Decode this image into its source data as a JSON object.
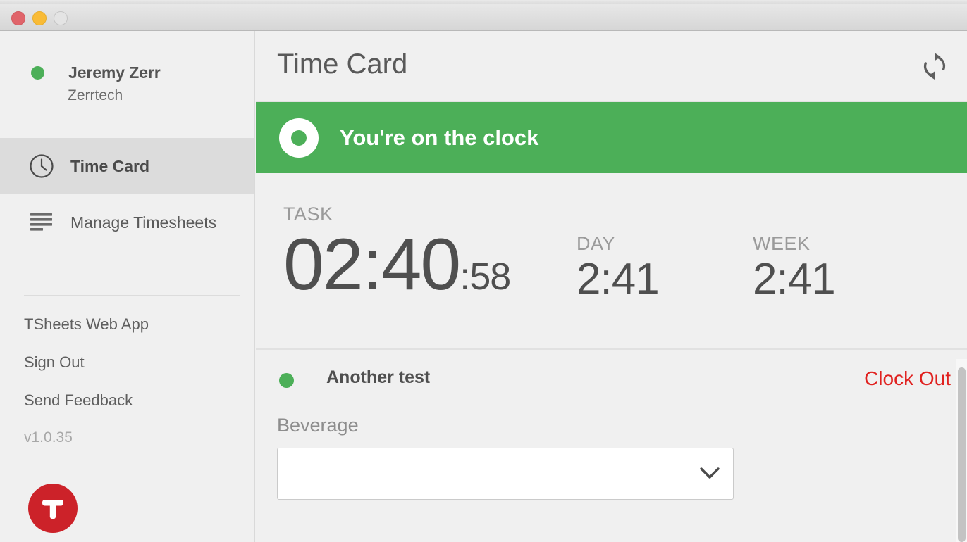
{
  "window": {
    "traffic_lights": [
      "close",
      "minimize",
      "zoom"
    ]
  },
  "sidebar": {
    "profile": {
      "status": "online",
      "name": "Jeremy Zerr",
      "company": "Zerrtech"
    },
    "nav_items": [
      {
        "label": "Time Card",
        "icon": "clock-icon",
        "active": true
      },
      {
        "label": "Manage Timesheets",
        "icon": "list-lines-icon",
        "active": false
      }
    ],
    "links": [
      {
        "label": "TSheets Web App"
      },
      {
        "label": "Sign Out"
      },
      {
        "label": "Send Feedback"
      }
    ],
    "version": "v1.0.35",
    "logo_letter": "T"
  },
  "content": {
    "header": {
      "title": "Time Card",
      "refresh_icon": "refresh-icon"
    },
    "status_banner": {
      "text": "You're on the clock",
      "color": "#4caf58"
    },
    "timers": [
      {
        "key": "task",
        "label": "TASK",
        "main": "02:40",
        "seconds": ":58"
      },
      {
        "key": "day",
        "label": "DAY",
        "main": "2:41",
        "seconds": ""
      },
      {
        "key": "week",
        "label": "WEEK",
        "main": "2:41",
        "seconds": ""
      }
    ],
    "entry": {
      "status": "active",
      "name": "Another test",
      "clock_out_label": "Clock Out",
      "clock_out_color": "#e0211f",
      "fields": [
        {
          "label": "Beverage",
          "value": "",
          "type": "select"
        }
      ]
    }
  }
}
